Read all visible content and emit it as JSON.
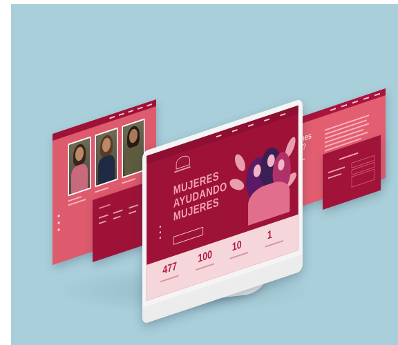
{
  "hero": {
    "line1": "MUJERES",
    "line2": "AYUDANDO",
    "line3": "MUJERES"
  },
  "stats": [
    {
      "value": "477"
    },
    {
      "value": "100"
    },
    {
      "value": "10"
    },
    {
      "value": "1"
    }
  ],
  "about": {
    "title_line1": "¿Quiénes",
    "title_line2": "somos?"
  },
  "colors": {
    "background": "#a9cfda",
    "brand_dark": "#9e1238",
    "brand_light": "#de5a6d",
    "stats_bg": "#f5d6db"
  }
}
